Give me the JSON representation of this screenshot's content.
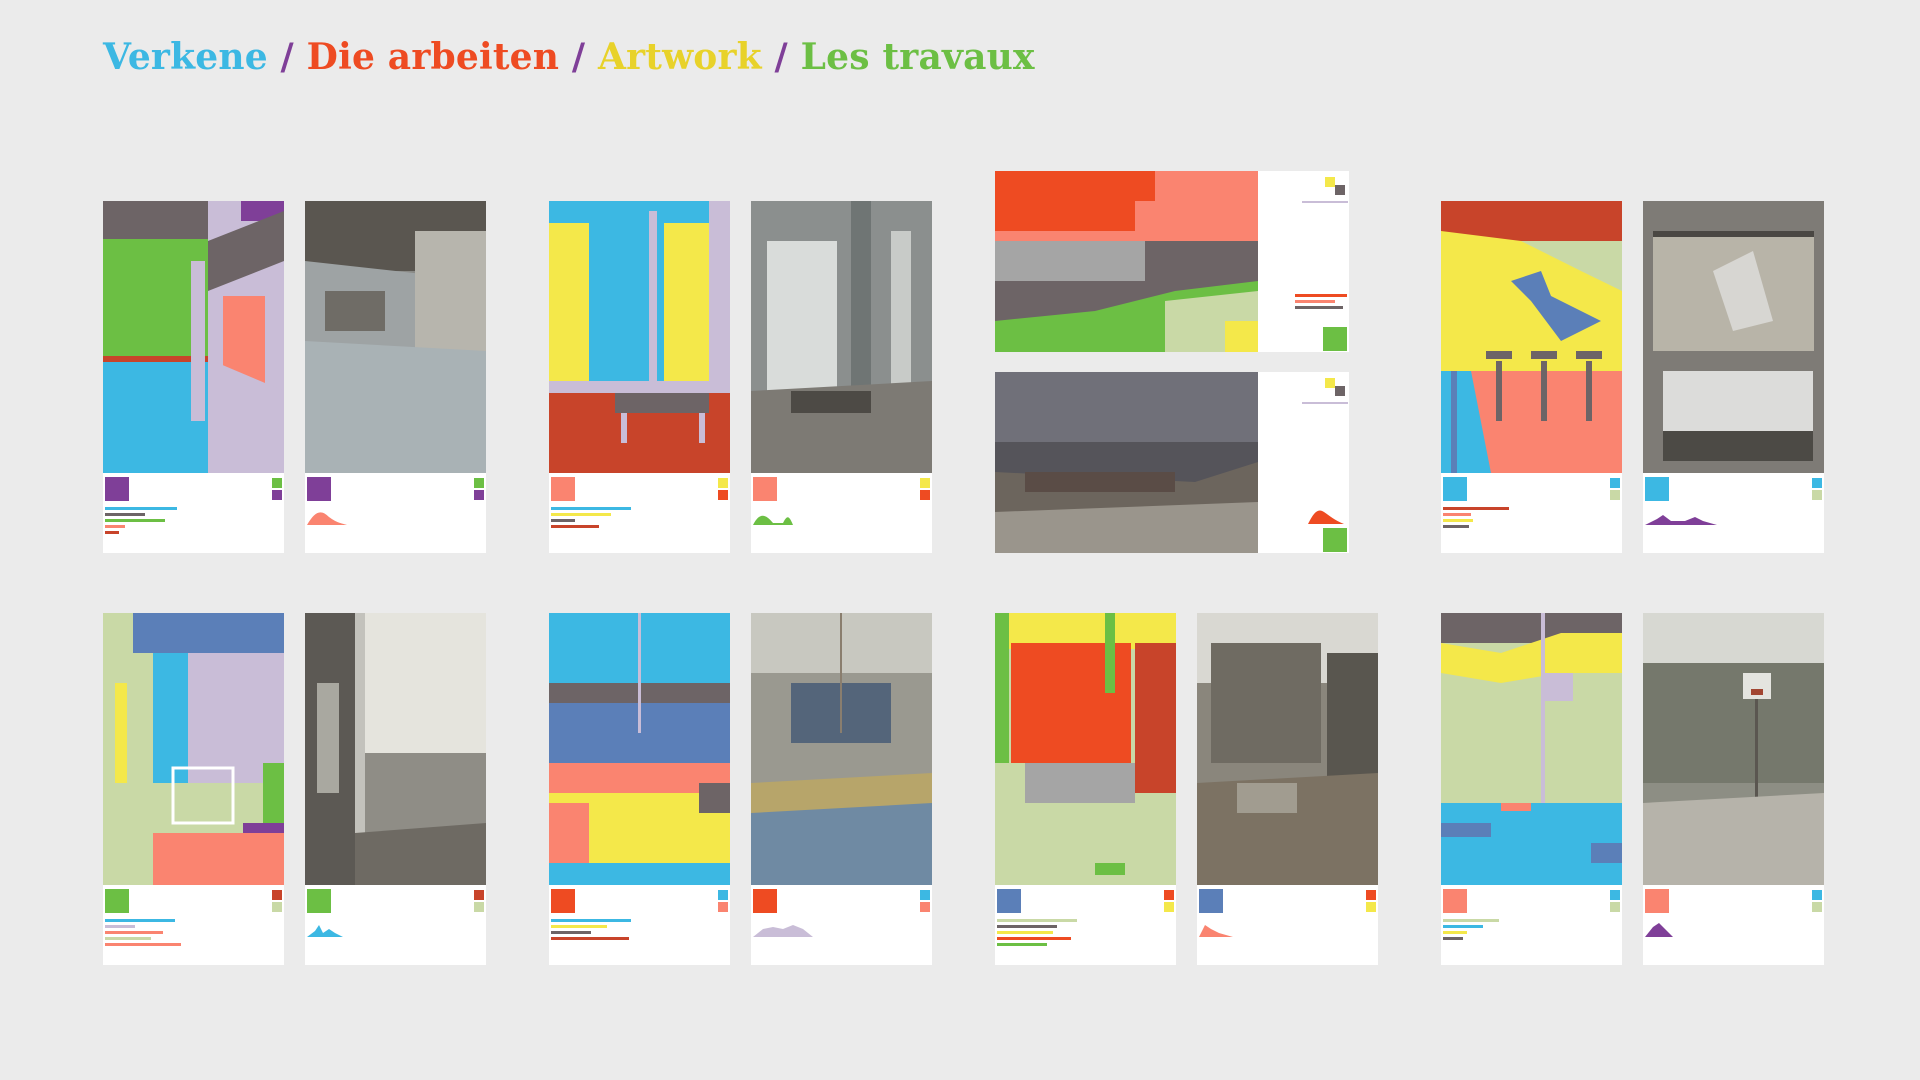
{
  "heading": {
    "parts": [
      {
        "text": "Verkene",
        "color": "#3cb8e3"
      },
      {
        "text": " / ",
        "color": "#7f3f98"
      },
      {
        "text": "Die arbeiten",
        "color": "#ee4b22"
      },
      {
        "text": " / ",
        "color": "#7f3f98"
      },
      {
        "text": "Artwork ",
        "color": "#e8d22a"
      },
      {
        "text": " / ",
        "color": "#7f3f98"
      },
      {
        "text": "Les travaux",
        "color": "#6cbf44"
      }
    ]
  },
  "palette": {
    "blue": "#3cb8e3",
    "purple": "#7f3f98",
    "red": "#ee4b22",
    "yellow": "#f4e84a",
    "green": "#6cbf44",
    "salmon": "#fa8470",
    "lilac": "#c9bdd7",
    "grey": "#6d6466",
    "sage": "#c9d9a6",
    "rust": "#c8442a",
    "steel": "#5b7fb8"
  },
  "artworks": [
    {
      "id": "pool-hall",
      "kind": "pixel-art"
    },
    {
      "id": "pool-hall",
      "kind": "photo"
    },
    {
      "id": "window-room",
      "kind": "pixel-art"
    },
    {
      "id": "window-room",
      "kind": "photo"
    },
    {
      "id": "auditorium",
      "kind": "pixel-art"
    },
    {
      "id": "auditorium",
      "kind": "photo"
    },
    {
      "id": "diving-tower",
      "kind": "pixel-art"
    },
    {
      "id": "diving-tower",
      "kind": "photo"
    },
    {
      "id": "nursery",
      "kind": "pixel-art"
    },
    {
      "id": "nursery",
      "kind": "photo"
    },
    {
      "id": "gymnasium",
      "kind": "pixel-art"
    },
    {
      "id": "gymnasium",
      "kind": "photo"
    },
    {
      "id": "red-doors",
      "kind": "pixel-art"
    },
    {
      "id": "red-doors",
      "kind": "photo"
    },
    {
      "id": "basketball",
      "kind": "pixel-art"
    },
    {
      "id": "basketball",
      "kind": "photo"
    }
  ]
}
